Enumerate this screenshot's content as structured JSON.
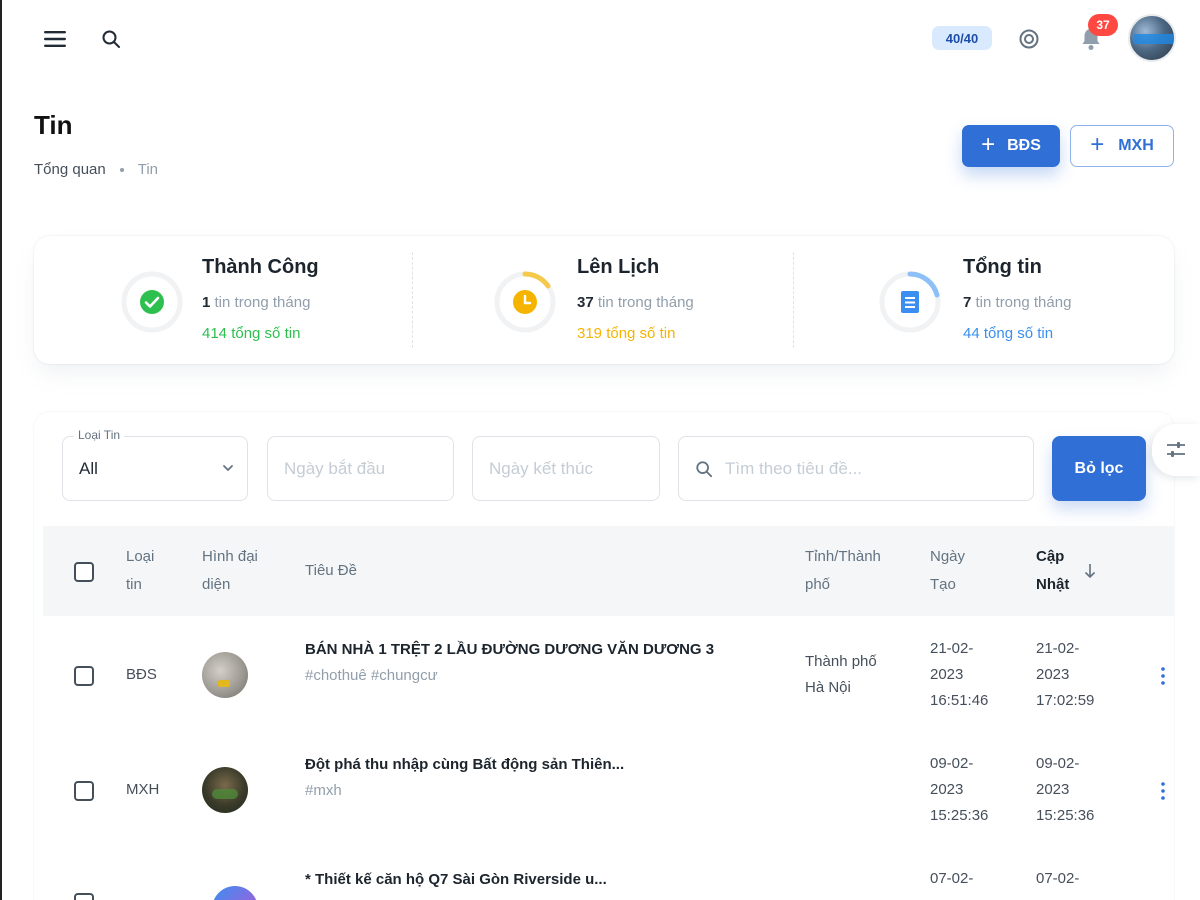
{
  "topbar": {
    "menu_icon": "menu-icon",
    "search_icon": "search-icon",
    "quota": "40/40",
    "settings_icon": "gear-icon",
    "notification_icon": "bell-icon",
    "notification_count": "37"
  },
  "header": {
    "title": "Tin",
    "breadcrumb": [
      "Tổng quan",
      "Tin"
    ],
    "add_bds_label": "BĐS",
    "add_mxh_label": "MXH"
  },
  "stats": [
    {
      "title": "Thành Công",
      "month_count": "1",
      "month_suffix": " tin trong tháng",
      "total": "414 tổng số tin",
      "color": "#2ec04f",
      "icon": "check-circle-icon"
    },
    {
      "title": "Lên Lịch",
      "month_count": "37",
      "month_suffix": " tin trong tháng",
      "total": "319 tổng số tin",
      "color": "#f5b400",
      "icon": "clock-icon"
    },
    {
      "title": "Tổng tin",
      "month_count": "7",
      "month_suffix": " tin trong tháng",
      "total": "44 tổng số tin",
      "color": "#3b8ff0",
      "icon": "document-icon"
    }
  ],
  "filters": {
    "type_label": "Loại Tin",
    "type_value": "All",
    "start_placeholder": "Ngày bắt đầu",
    "end_placeholder": "Ngày kết thúc",
    "search_placeholder": "Tìm theo tiêu đề...",
    "clear_label": "Bỏ lọc"
  },
  "table": {
    "headers": {
      "type": [
        "Loại",
        "tin"
      ],
      "avatar": [
        "Hình đại",
        "diện"
      ],
      "title": "Tiêu Đề",
      "city": [
        "Tỉnh/Thành",
        "phố"
      ],
      "created": [
        "Ngày",
        "Tạo"
      ],
      "updated": [
        "Cập",
        "Nhật"
      ]
    },
    "rows": [
      {
        "type": "BĐS",
        "title": "BÁN NHÀ 1 TRỆT 2 LẦU ĐƯỜNG DƯƠNG VĂN DƯƠNG 3",
        "tags": "#chothuê #chungcư",
        "city": [
          "Thành phố",
          "Hà Nội"
        ],
        "created": [
          "21-02-",
          "2023",
          "16:51:46"
        ],
        "updated": [
          "21-02-",
          "2023",
          "17:02:59"
        ]
      },
      {
        "type": "MXH",
        "title": "Đột phá thu nhập cùng Bất động sản Thiên...",
        "tags": "#mxh",
        "city": [
          "",
          ""
        ],
        "created": [
          "09-02-",
          "2023",
          "15:25:36"
        ],
        "updated": [
          "09-02-",
          "2023",
          "15:25:36"
        ]
      },
      {
        "type": "",
        "title": "* Thiết kế căn hộ Q7 Sài Gòn Riverside u...",
        "tags": "",
        "city": [
          "",
          ""
        ],
        "created": [
          "07-02-",
          "",
          ""
        ],
        "updated": [
          "07-02-",
          "",
          ""
        ]
      }
    ]
  }
}
